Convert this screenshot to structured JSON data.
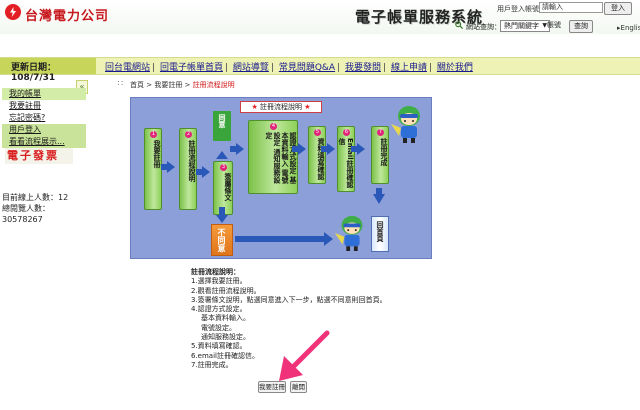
{
  "header": {
    "company_name": "台灣電力公司",
    "site_title": "電子帳單服務系統",
    "login": {
      "label": "用戶登入帳號：",
      "input_value": "請輸入",
      "button": "登入"
    },
    "search": {
      "label": "網站查詢：",
      "select_value": "熱門關鍵字",
      "input_value": "帳號",
      "button": "查詢"
    },
    "english_link": "English"
  },
  "nav": {
    "update_date": "更新日期：108/7/31",
    "links": [
      "回台電網站",
      "回電子帳單首頁",
      "網站導覽",
      "常見問題Q&A",
      "我要發問",
      "線上申請",
      "關於我們"
    ]
  },
  "sidebar": {
    "items": [
      {
        "label": "我的帳單"
      },
      {
        "label": "我要註冊"
      },
      {
        "label": "忘記密碼?"
      },
      {
        "label": "用戶登入"
      },
      {
        "label": "看看流程展示..."
      }
    ],
    "collapse_icon": "«",
    "banner": "電子發票",
    "online_label": "目前線上人數：12",
    "total_label": "總閱覽人數：",
    "total_value": "30578267"
  },
  "breadcrumb": {
    "dots": "::",
    "home": "首頁",
    "sep1": " > ",
    "parent": "我要註冊",
    "sep2": " > ",
    "current": "註冊流程說明"
  },
  "flow": {
    "title": "註冊流程說明",
    "title_stars": "★",
    "steps": [
      {
        "num": "1",
        "text": "我要註冊"
      },
      {
        "num": "2",
        "text": "註冊流程說明"
      },
      {
        "num": "3",
        "text": "簽屬條文"
      },
      {
        "num": "4",
        "text": "認證方式設定 基本資料輸入 電號設定 通知服務設定"
      },
      {
        "num": "5",
        "text": "資料填寫確認"
      },
      {
        "num": "6",
        "text": "Email註冊確認信"
      },
      {
        "num": "7",
        "text": "註冊完成"
      }
    ],
    "agree": "同意",
    "disagree": "不同意",
    "home": "回首頁",
    "colors": {
      "background": "#8c9fd9",
      "arrow": "#2a58b8",
      "step": "#7cc24a",
      "orange": "#f08a2a"
    }
  },
  "instructions": {
    "heading": "註冊流程說明：",
    "lines": [
      "1.選擇我要註冊。",
      "2.觀看註冊流程說明。",
      "3.簽署條文說明，點選同意進入下一步，點選不同意則回首頁。",
      "4.認證方式設定。",
      "基本資料輸入。",
      "電號設定。",
      "通知服務設定。",
      "5.資料填寫確認。",
      "6.email註冊確認信。",
      "7.註冊完成。"
    ]
  },
  "buttons": {
    "register": "我要註冊",
    "leave": "離開"
  }
}
